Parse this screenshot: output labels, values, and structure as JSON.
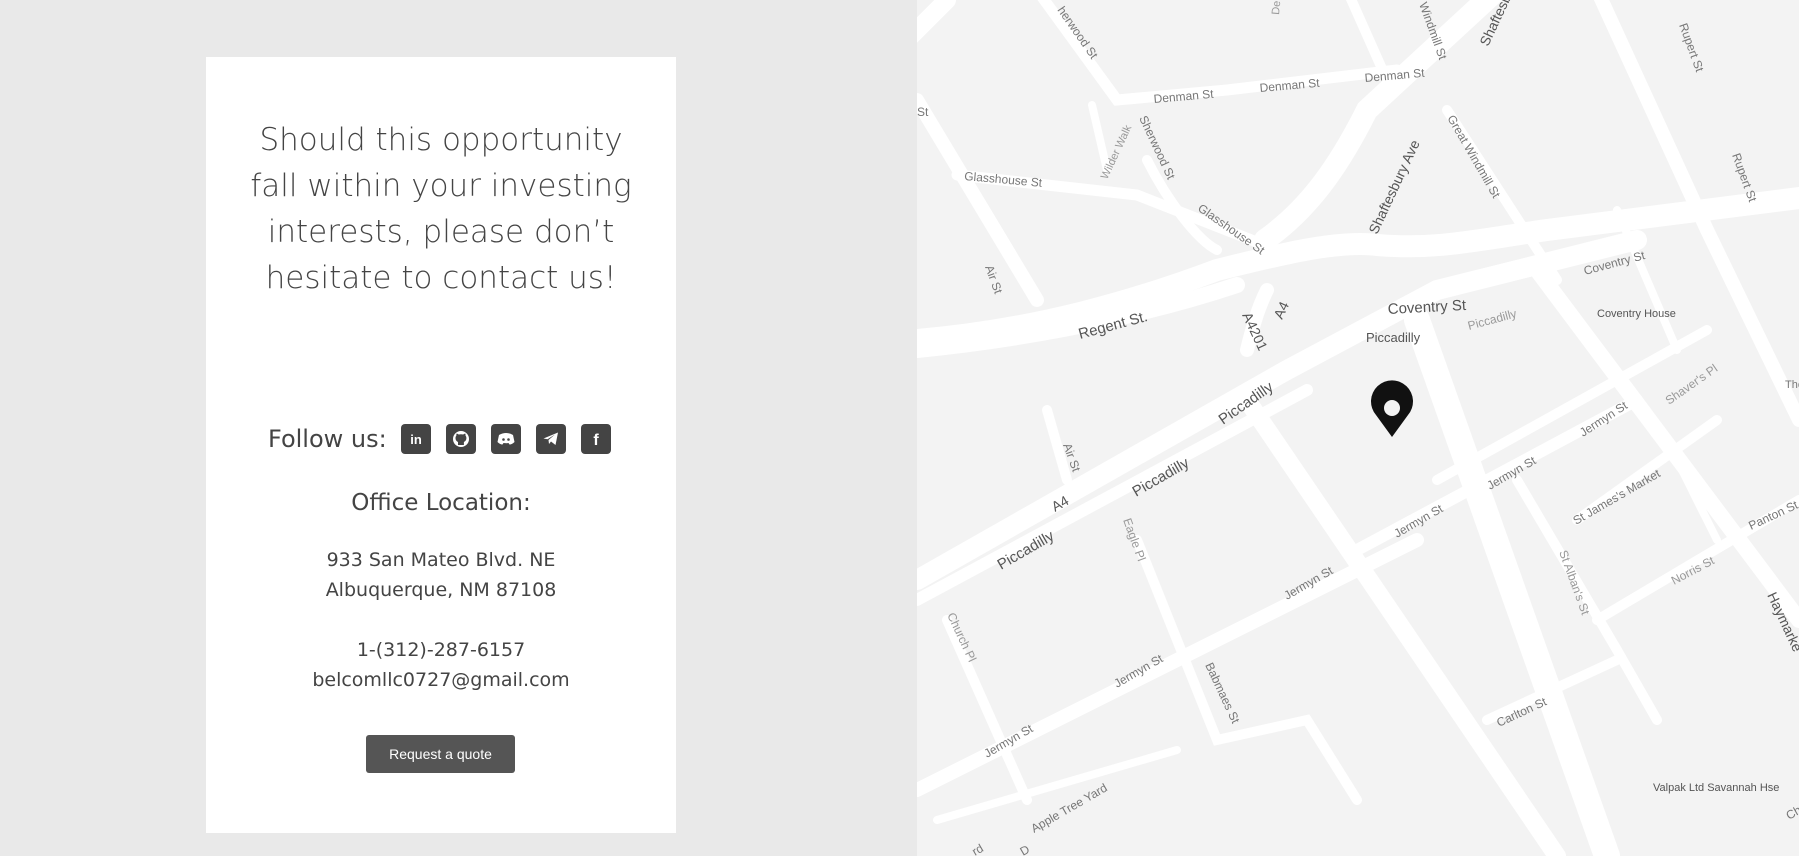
{
  "card": {
    "headline": "Should this opportunity fall within your investing interests, please don’t hesitate to contact us!",
    "follow_label": "Follow us:",
    "socials": [
      {
        "name": "linkedin-icon",
        "glyph": "in"
      },
      {
        "name": "github-icon"
      },
      {
        "name": "discord-icon"
      },
      {
        "name": "telegram-icon"
      },
      {
        "name": "facebook-icon",
        "glyph": "f"
      }
    ],
    "office_title": "Office Location:",
    "address_line1": "933 San Mateo Blvd. NE",
    "address_line2": "Albuquerque, NM 87108",
    "phone": "1-(312)-287-6157",
    "email": "belcomllc0727@gmail.com",
    "quote_button": "Request a quote"
  },
  "map": {
    "labels": {
      "sherwood_st_top": "herwood St",
      "denman_1": "Denman St",
      "denman_2": "Denman St",
      "denman_3": "Denman St",
      "windmill_top": "Windmill St",
      "shaftesbury_top": "Shaftesb",
      "rupert_1": "Rupert St",
      "rupert_2": "Rupert St",
      "st_edge": "St",
      "wilder_walk": "Wilder Walk",
      "sherwood_st": "Sherwood St",
      "glasshouse_1": "Glasshouse St",
      "glasshouse_2": "Glasshouse St",
      "shaftesbury_ave": "Shaftesbury Ave",
      "great_windmill": "Great Windmill St",
      "air_st_1": "Air St",
      "regent_st": "Regent St.",
      "a4201": "A4201",
      "a4_top": "A4",
      "coventry_1": "Coventry St",
      "coventry_2": "Coventry St",
      "piccadilly_small": "Piccadilly",
      "piccadilly_label": "Piccadilly",
      "coventry_house": "Coventry House",
      "shavers_pl": "Shaver's Pl",
      "the_edge": "The",
      "piccadilly_2": "Piccadilly",
      "air_st_2": "Air St",
      "jermyn_1": "Jermyn St",
      "jermyn_2": "Jermyn St",
      "jermyn_3": "Jermyn St",
      "a4_mid": "A4",
      "piccadilly_3": "Piccadilly",
      "st_james_market": "St James's Market",
      "panton_st": "Panton St",
      "eagle_pl": "Eagle Pl",
      "piccadilly_4": "Piccadilly",
      "st_albans": "St Alban's St",
      "norris_st": "Norris St",
      "haymarket": "Haymarke",
      "jermyn_4": "Jermyn St",
      "church_pl": "Church Pl",
      "jermyn_5": "Jermyn St",
      "babmaes": "Babmaes St",
      "carlton_st": "Carlton St",
      "jermyn_6": "Jermyn St",
      "apple_tree": "Apple Tree Yard",
      "valpak": "Valpak Ltd Savannah Hse",
      "rd_edge": "rd",
      "d_edge": "D",
      "ch_edge": "Ch",
      "de_edge": "De"
    }
  }
}
